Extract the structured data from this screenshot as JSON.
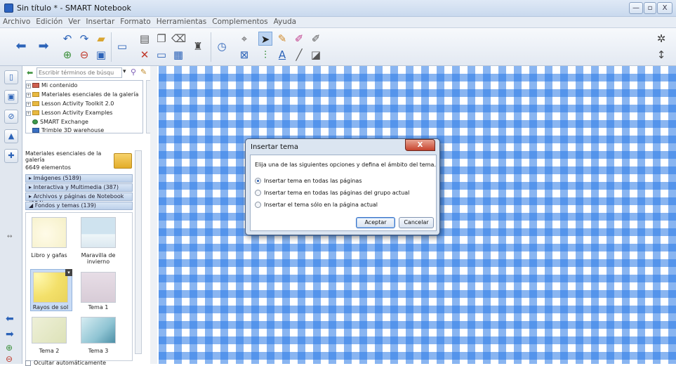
{
  "window": {
    "title": "Sin título * - SMART Notebook",
    "min": "—",
    "max": "▫",
    "close": "X"
  },
  "menu": [
    "Archivo",
    "Edición",
    "Ver",
    "Insertar",
    "Formato",
    "Herramientas",
    "Complementos",
    "Ayuda"
  ],
  "gallery": {
    "search_placeholder": "Escribir términos de búsqu",
    "tree": [
      {
        "label": "Mi contenido"
      },
      {
        "label": "Materiales esenciales de la galería"
      },
      {
        "label": "Lesson Activity Toolkit 2.0"
      },
      {
        "label": "Lesson Activity Examples"
      },
      {
        "label": "SMART Exchange"
      },
      {
        "label": "Trimble 3D warehouse"
      }
    ],
    "collection_title": "Materiales esenciales de la galería",
    "collection_count": "6649 elementos",
    "categories": [
      "Imágenes (5189)",
      "Interactiva y Multimedia (387)",
      "Archivos y páginas de Notebook (934)",
      "Fondos y temas (139)"
    ],
    "thumbnails": [
      {
        "label": "Libro y gafas"
      },
      {
        "label": "Maravilla de invierno"
      },
      {
        "label": "Rayos de sol"
      },
      {
        "label": "Tema 1"
      },
      {
        "label": "Tema 2"
      },
      {
        "label": "Tema 3"
      }
    ],
    "auto_hide_label": "Ocultar automáticamente"
  },
  "dialog": {
    "title": "Insertar tema",
    "close": "X",
    "instruction": "Elija una de las siguientes opciones y defina el ámbito del tema.",
    "options": [
      {
        "label": "Insertar tema en todas las páginas",
        "selected": true
      },
      {
        "label": "Insertar tema en todas las páginas del grupo actual",
        "selected": false
      },
      {
        "label": "Insertar el tema sólo en la página actual",
        "selected": false
      }
    ],
    "accept": "Aceptar",
    "cancel": "Cancelar"
  },
  "colors": {
    "accent": "#2c63b8",
    "check_blue": "#2878e6"
  }
}
